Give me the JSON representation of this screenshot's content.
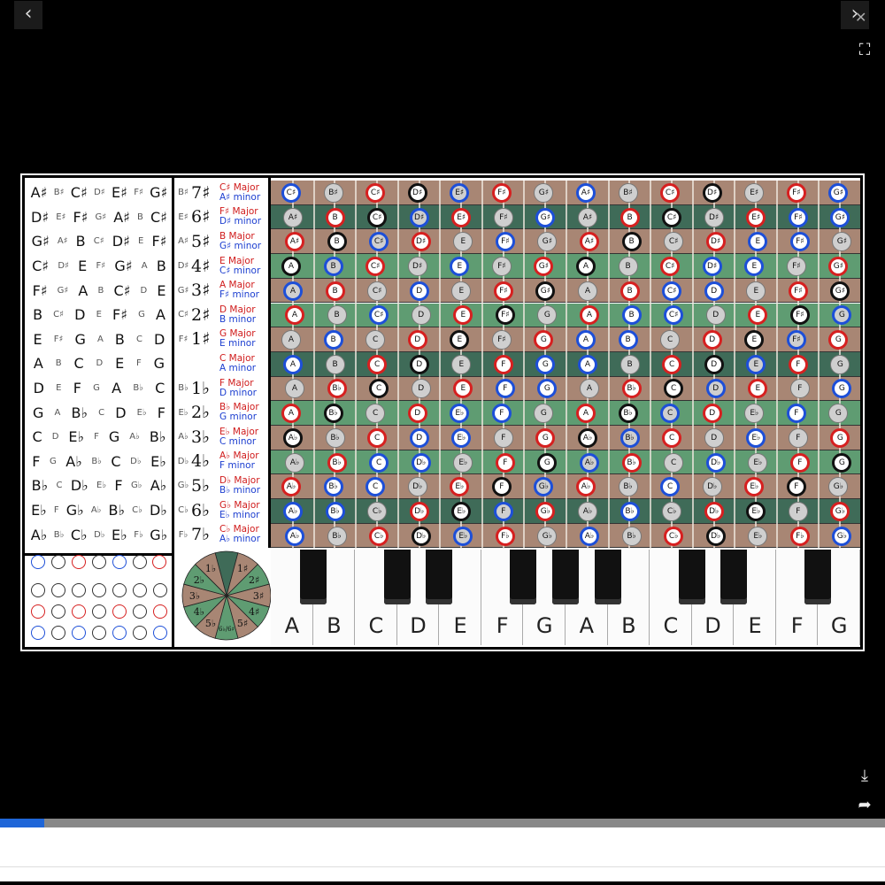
{
  "viewer": {
    "prev_icon": "‹",
    "next_icon": "›",
    "close_icon": "✕",
    "fullscreen_icon": "⛶",
    "download_icon": "⤓",
    "share_icon": "➦",
    "progress": 0.05
  },
  "colors": {
    "accent": "#1f66d8",
    "row_brown": "#a88674",
    "row_green": "#5f9c72",
    "row_dark": "#3f6b58"
  },
  "left_table": [
    [
      "A♯",
      "B♯",
      "C♯",
      "D♯",
      "E♯",
      "F♯",
      "G♯"
    ],
    [
      "D♯",
      "E♯",
      "F♯",
      "G♯",
      "A♯",
      "B",
      "C♯"
    ],
    [
      "G♯",
      "A♯",
      "B",
      "C♯",
      "D♯",
      "E",
      "F♯"
    ],
    [
      "C♯",
      "D♯",
      "E",
      "F♯",
      "G♯",
      "A",
      "B"
    ],
    [
      "F♯",
      "G♯",
      "A",
      "B",
      "C♯",
      "D",
      "E"
    ],
    [
      "B",
      "C♯",
      "D",
      "E",
      "F♯",
      "G",
      "A"
    ],
    [
      "E",
      "F♯",
      "G",
      "A",
      "B",
      "C",
      "D"
    ],
    [
      "A",
      "B",
      "C",
      "D",
      "E",
      "F",
      "G"
    ],
    [
      "D",
      "E",
      "F",
      "G",
      "A",
      "B♭",
      "C"
    ],
    [
      "G",
      "A",
      "B♭",
      "C",
      "D",
      "E♭",
      "F"
    ],
    [
      "C",
      "D",
      "E♭",
      "F",
      "G",
      "A♭",
      "B♭"
    ],
    [
      "F",
      "G",
      "A♭",
      "B♭",
      "C",
      "D♭",
      "E♭"
    ],
    [
      "B♭",
      "C",
      "D♭",
      "E♭",
      "F",
      "G♭",
      "A♭"
    ],
    [
      "E♭",
      "F",
      "G♭",
      "A♭",
      "B♭",
      "C♭",
      "D♭"
    ],
    [
      "A♭",
      "B♭",
      "C♭",
      "D♭",
      "E♭",
      "F♭",
      "G♭"
    ]
  ],
  "signatures": [
    {
      "small": "B♯",
      "num": "7♯",
      "major": "C♯ Major",
      "minor": "A♯ minor"
    },
    {
      "small": "E♯",
      "num": "6♯",
      "major": "F♯ Major",
      "minor": "D♯ minor"
    },
    {
      "small": "A♯",
      "num": "5♯",
      "major": "B Major",
      "minor": "G♯ minor"
    },
    {
      "small": "D♯",
      "num": "4♯",
      "major": "E Major",
      "minor": "C♯ minor"
    },
    {
      "small": "G♯",
      "num": "3♯",
      "major": "A Major",
      "minor": "F♯ minor"
    },
    {
      "small": "C♯",
      "num": "2♯",
      "major": "D Major",
      "minor": "B minor"
    },
    {
      "small": "F♯",
      "num": "1♯",
      "major": "G Major",
      "minor": "E minor"
    },
    {
      "small": "",
      "num": "",
      "major": "C Major",
      "minor": "A minor"
    },
    {
      "small": "B♭",
      "num": "1♭",
      "major": "F Major",
      "minor": "D minor"
    },
    {
      "small": "E♭",
      "num": "2♭",
      "major": "B♭ Major",
      "minor": "G minor"
    },
    {
      "small": "A♭",
      "num": "3♭",
      "major": "E♭ Major",
      "minor": "C minor"
    },
    {
      "small": "D♭",
      "num": "4♭",
      "major": "A♭ Major",
      "minor": "F minor"
    },
    {
      "small": "G♭",
      "num": "5♭",
      "major": "D♭ Major",
      "minor": "B♭ minor"
    },
    {
      "small": "C♭",
      "num": "6♭",
      "major": "G♭ Major",
      "minor": "E♭ minor"
    },
    {
      "small": "F♭",
      "num": "7♭",
      "major": "C♭ Major",
      "minor": "A♭ minor"
    }
  ],
  "circle": {
    "labels": [
      "1♯",
      "2♯",
      "3♯",
      "4♯",
      "5♯",
      "6♭/6♯",
      "5♭",
      "4♭",
      "3♭",
      "2♭",
      "1♭"
    ]
  },
  "row_colors": [
    "brown",
    "dark",
    "brown",
    "green",
    "brown",
    "green",
    "brown",
    "dark",
    "brown",
    "green",
    "brown",
    "green",
    "brown",
    "dark",
    "brown"
  ],
  "fret_notes": [
    [
      "C♯",
      "B♯",
      "C♯",
      "D♯",
      "E♯",
      "F♯",
      "G♯",
      "A♯",
      "B♯",
      "C♯",
      "D♯",
      "E♯",
      "F♯",
      "G♯"
    ],
    [
      "A♯",
      "B",
      "C♯",
      "D♯",
      "E♯",
      "F♯",
      "G♯",
      "A♯",
      "B",
      "C♯",
      "D♯",
      "E♯",
      "F♯",
      "G♯"
    ],
    [
      "A♯",
      "B",
      "C♯",
      "D♯",
      "E",
      "F♯",
      "G♯",
      "A♯",
      "B",
      "C♯",
      "D♯",
      "E",
      "F♯",
      "G♯"
    ],
    [
      "A",
      "B",
      "C♯",
      "D♯",
      "E",
      "F♯",
      "G♯",
      "A",
      "B",
      "C♯",
      "D♯",
      "E",
      "F♯",
      "G♯"
    ],
    [
      "A",
      "B",
      "C♯",
      "D",
      "E",
      "F♯",
      "G♯",
      "A",
      "B",
      "C♯",
      "D",
      "E",
      "F♯",
      "G♯"
    ],
    [
      "A",
      "B",
      "C♯",
      "D",
      "E",
      "F♯",
      "G",
      "A",
      "B",
      "C♯",
      "D",
      "E",
      "F♯",
      "G"
    ],
    [
      "A",
      "B",
      "C",
      "D",
      "E",
      "F♯",
      "G",
      "A",
      "B",
      "C",
      "D",
      "E",
      "F♯",
      "G"
    ],
    [
      "A",
      "B",
      "C",
      "D",
      "E",
      "F",
      "G",
      "A",
      "B",
      "C",
      "D",
      "E",
      "F",
      "G"
    ],
    [
      "A",
      "B♭",
      "C",
      "D",
      "E",
      "F",
      "G",
      "A",
      "B♭",
      "C",
      "D",
      "E",
      "F",
      "G"
    ],
    [
      "A",
      "B♭",
      "C",
      "D",
      "E♭",
      "F",
      "G",
      "A",
      "B♭",
      "C",
      "D",
      "E♭",
      "F",
      "G"
    ],
    [
      "A♭",
      "B♭",
      "C",
      "D",
      "E♭",
      "F",
      "G",
      "A♭",
      "B♭",
      "C",
      "D",
      "E♭",
      "F",
      "G"
    ],
    [
      "A♭",
      "B♭",
      "C",
      "D♭",
      "E♭",
      "F",
      "G",
      "A♭",
      "B♭",
      "C",
      "D♭",
      "E♭",
      "F",
      "G"
    ],
    [
      "A♭",
      "B♭",
      "C",
      "D♭",
      "E♭",
      "F",
      "G♭",
      "A♭",
      "B♭",
      "C",
      "D♭",
      "E♭",
      "F",
      "G♭"
    ],
    [
      "A♭",
      "B♭",
      "C♭",
      "D♭",
      "E♭",
      "F",
      "G♭",
      "A♭",
      "B♭",
      "C♭",
      "D♭",
      "E♭",
      "F",
      "G♭"
    ],
    [
      "A♭",
      "B♭",
      "C♭",
      "D♭",
      "E♭",
      "F♭",
      "G♭",
      "A♭",
      "B♭",
      "C♭",
      "D♭",
      "E♭",
      "F♭",
      "G♭"
    ]
  ],
  "piano": {
    "white_keys": [
      "A",
      "B",
      "C",
      "D",
      "E",
      "F",
      "G",
      "A",
      "B",
      "C",
      "D",
      "E",
      "F",
      "G"
    ]
  }
}
